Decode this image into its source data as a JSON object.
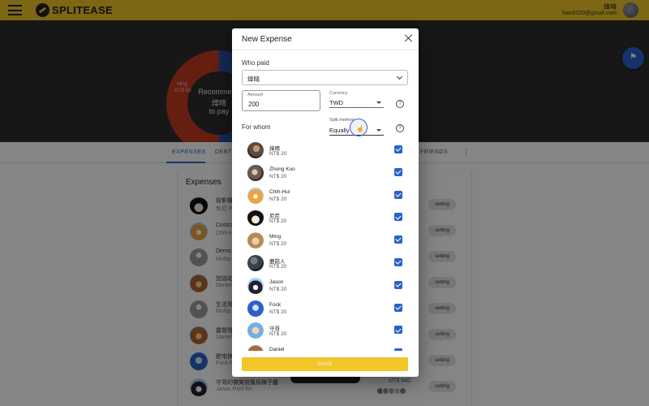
{
  "app": {
    "brand": "SPLITEASE",
    "user_name": "煒晴",
    "user_email": "hwc0320@gmail.com"
  },
  "hero": {
    "donut_title": "Recommend",
    "donut_name": "煒晴",
    "donut_action": "to pay",
    "segment_name": "Ming",
    "segment_value": "-NT$ 50"
  },
  "tabs": [
    {
      "label": "EXPENSES"
    },
    {
      "label": "DEBTS"
    },
    {
      "label": "FRIENDS"
    }
  ],
  "expenses": {
    "title": "Expenses",
    "rows": [
      {
        "title": "投影機",
        "sub": "煎尼 P",
        "chip": "setting",
        "amount": ""
      },
      {
        "title": "Costco",
        "sub": "Chih-H",
        "chip": "setting",
        "amount": ""
      },
      {
        "title": "Demo",
        "sub": "Multip",
        "chip": "setting",
        "amount": ""
      },
      {
        "title": "加油站",
        "sub": "Daniel",
        "chip": "setting",
        "amount": ""
      },
      {
        "title": "生活用",
        "sub": "Multip",
        "chip": "setting",
        "amount": ""
      },
      {
        "title": "露營燈",
        "sub": "Daniel",
        "chip": "setting",
        "amount": ""
      },
      {
        "title": "肥宅快",
        "sub": "Fock F",
        "chip": "setting",
        "amount": ""
      },
      {
        "title": "守哥的微笑就像烏梅子醬",
        "sub": "Jason Paid for",
        "chip": "setting",
        "amount": "NT$ 540"
      }
    ]
  },
  "dialog": {
    "title": "New Expense",
    "who_paid_label": "Who paid",
    "who_paid_value": "煒晴",
    "amount_label": "Amount",
    "amount_value": "200",
    "currency_label": "Currency",
    "currency_value": "TWD",
    "help_glyph": "?",
    "for_whom_label": "For whom",
    "split_label": "Split method",
    "split_value": "Equally",
    "save_label": "SAVE",
    "members": [
      {
        "name": "煒晴",
        "share": "NT$ 20",
        "checked": true,
        "avatar": "photo1"
      },
      {
        "name": "Zhong Kuo",
        "share": "NT$ 20",
        "checked": true,
        "avatar": "photo2"
      },
      {
        "name": "Chih-Hui",
        "share": "NT$ 20",
        "checked": true,
        "avatar": "tiger"
      },
      {
        "name": "尼尼",
        "share": "NT$ 20",
        "checked": true,
        "avatar": "girl"
      },
      {
        "name": "Ming",
        "share": "NT$ 20",
        "checked": true,
        "avatar": "dog"
      },
      {
        "name": "蘑菇人",
        "share": "NT$ 20",
        "checked": true,
        "avatar": "dark"
      },
      {
        "name": "Jason",
        "share": "NT$ 20",
        "checked": true,
        "avatar": "penguin"
      },
      {
        "name": "Fock",
        "share": "NT$ 20",
        "checked": true,
        "avatar": "jelly"
      },
      {
        "name": "守哥",
        "share": "NT$ 20",
        "checked": true,
        "avatar": "baby"
      },
      {
        "name": "Daniel",
        "share": "",
        "checked": true,
        "avatar": "bear"
      }
    ]
  },
  "colors": {
    "brand_yellow": "#f0c628",
    "accent_blue": "#2a62c9",
    "pie_blue": "#2550a8",
    "pie_red": "#c43b22"
  }
}
